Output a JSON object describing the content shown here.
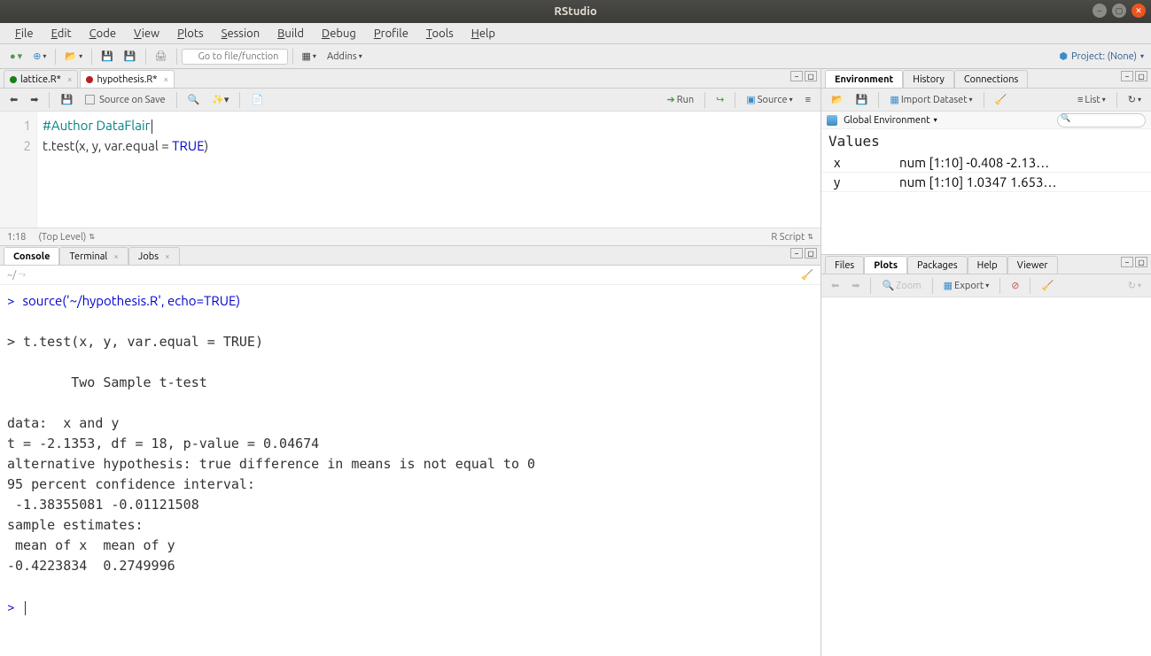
{
  "title": "RStudio",
  "menu": [
    "File",
    "Edit",
    "Code",
    "View",
    "Plots",
    "Session",
    "Build",
    "Debug",
    "Profile",
    "Tools",
    "Help"
  ],
  "toolbar": {
    "goto_placeholder": "Go to file/function",
    "addins": "Addins",
    "project": "Project: (None)"
  },
  "editor": {
    "tabs": [
      {
        "label": "lattice.R*",
        "icon_color": "#1a7f1a"
      },
      {
        "label": "hypothesis.R*",
        "icon_color": "#b92020"
      }
    ],
    "active_tab": 1,
    "source_on_save": "Source on Save",
    "run": "Run",
    "source": "Source",
    "lines": [
      {
        "n": "1",
        "content": "#Author DataFlair",
        "kind": "comment"
      },
      {
        "n": "2",
        "content": "t.test(x, y, var.equal = TRUE)",
        "kind": "code"
      }
    ],
    "status_pos": "1:18",
    "status_scope": "(Top Level)",
    "status_lang": "R Script"
  },
  "console": {
    "tabs": [
      "Console",
      "Terminal",
      "Jobs"
    ],
    "path": "~/",
    "output": "> source('~/hypothesis.R', echo=TRUE)\n\n> t.test(x, y, var.equal = TRUE)\n\n        Two Sample t-test\n\ndata:  x and y\nt = -2.1353, df = 18, p-value = 0.04674\nalternative hypothesis: true difference in means is not equal to 0\n95 percent confidence interval:\n -1.38355081 -0.01121508\nsample estimates:\n mean of x  mean of y \n-0.4223834  0.2749996 \n\n> "
  },
  "env": {
    "tabs": [
      "Environment",
      "History",
      "Connections"
    ],
    "import": "Import Dataset",
    "list": "List",
    "scope": "Global Environment",
    "section": "Values",
    "vars": [
      {
        "name": "x",
        "value": "num [1:10] -0.408 -2.13…"
      },
      {
        "name": "y",
        "value": "num [1:10] 1.0347 1.653…"
      }
    ]
  },
  "plots": {
    "tabs": [
      "Files",
      "Plots",
      "Packages",
      "Help",
      "Viewer"
    ],
    "zoom": "Zoom",
    "export": "Export"
  }
}
